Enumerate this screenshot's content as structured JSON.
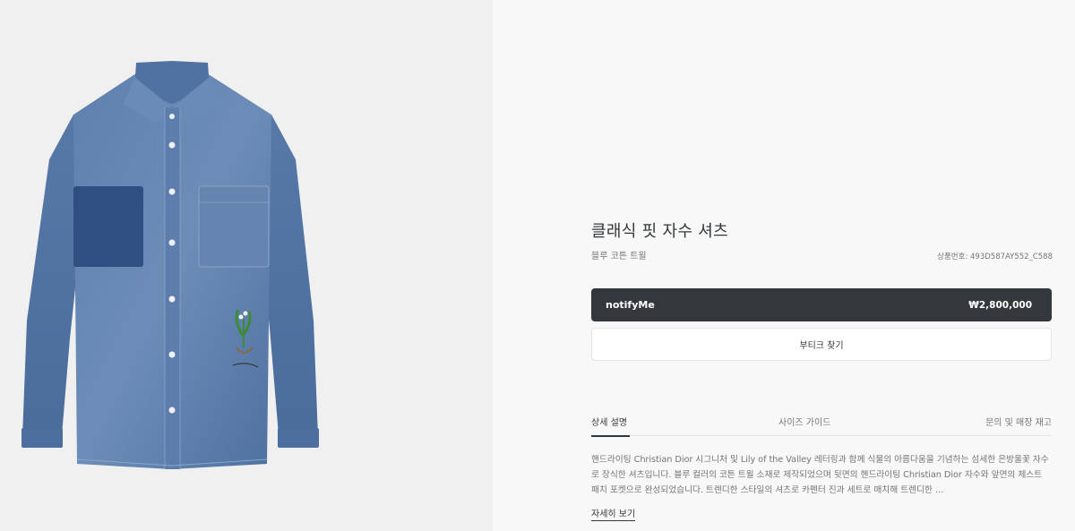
{
  "product": {
    "image_alt": "denim shirt",
    "title": "클래식 핏 자수 셔츠",
    "subtitle": "블루 코튼 트윌",
    "sku": "상품번호: 493D587AY552_C588"
  },
  "actions": {
    "notify_label": "notifyMe",
    "price": "₩2,800,000",
    "store_label": "부티크 찾기"
  },
  "tabs": [
    {
      "label": "상세 설명",
      "active": true
    },
    {
      "label": "사이즈 가이드",
      "active": false
    },
    {
      "label": "문의 및 매장 재고",
      "active": false
    }
  ],
  "description": {
    "text": "핸드라이팅 Christian Dior 시그니처 및 Lily of the Valley 레터링과 함께 식물의 아름다움을 기념하는 섬세한 은방울꽃 자수로 장식한 셔츠입니다. 블루 컬러의 코튼 트윌 소재로 제작되었으며 뒷면의 핸드라이팅 Christian Dior 자수와 앞면의 체스트 패치 포켓으로 완성되었습니다. 트렌디한 스타일의 셔츠로 카펜터 진과 세트로 매치해 트렌디한 …",
    "more_label": "자세히 보기"
  },
  "colors": {
    "dark": "#33383c",
    "muted": "#757575",
    "denim": "#4a6fa0"
  }
}
